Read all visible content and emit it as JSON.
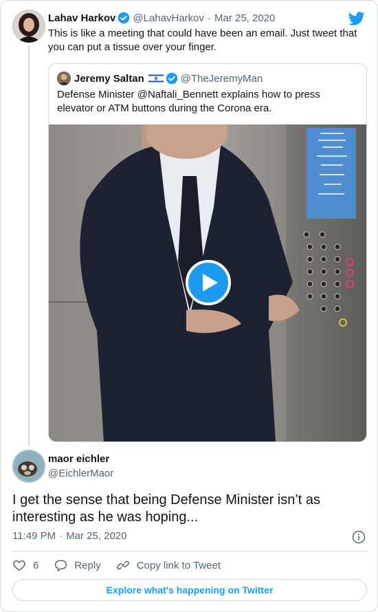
{
  "parent_tweet": {
    "display_name": "Lahav Harkov",
    "handle": "@LahavHarkov",
    "separator": "·",
    "date": "Mar 25, 2020",
    "text": "This is like a meeting that could have been an email. Just tweet that you can put a tissue over your finger."
  },
  "quoted_tweet": {
    "display_name": "Jeremy Saltan",
    "handle": "@TheJeremyMan",
    "text": "Defense Minister @Naftali_Bennett explains how to press elevator or ATM buttons during the Corona era.",
    "media": {
      "type": "video",
      "play_icon": "play-icon"
    }
  },
  "reply_tweet": {
    "display_name": "maor eichler",
    "handle": "@EichlerMaor",
    "text": "I get the sense that being Defense Minister isn’t as interesting as he was hoping...",
    "time": "11:49 PM",
    "separator": "·",
    "date": "Mar 25, 2020"
  },
  "actions": {
    "likes_count": "6",
    "reply_label": "Reply",
    "copy_link_label": "Copy link to Tweet"
  },
  "footer": {
    "explore_label": "Explore what's happening on Twitter"
  },
  "icons": {
    "brand": "twitter-bird-icon",
    "verified": "verified-badge-icon",
    "flag": "israel-flag-icon",
    "info": "info-icon",
    "like": "heart-icon",
    "reply": "reply-bubble-icon",
    "copy_link": "link-icon"
  },
  "colors": {
    "accent": "#1d9bf0",
    "text": "#0f1419",
    "muted": "#536471",
    "border": "#cfd9de"
  }
}
